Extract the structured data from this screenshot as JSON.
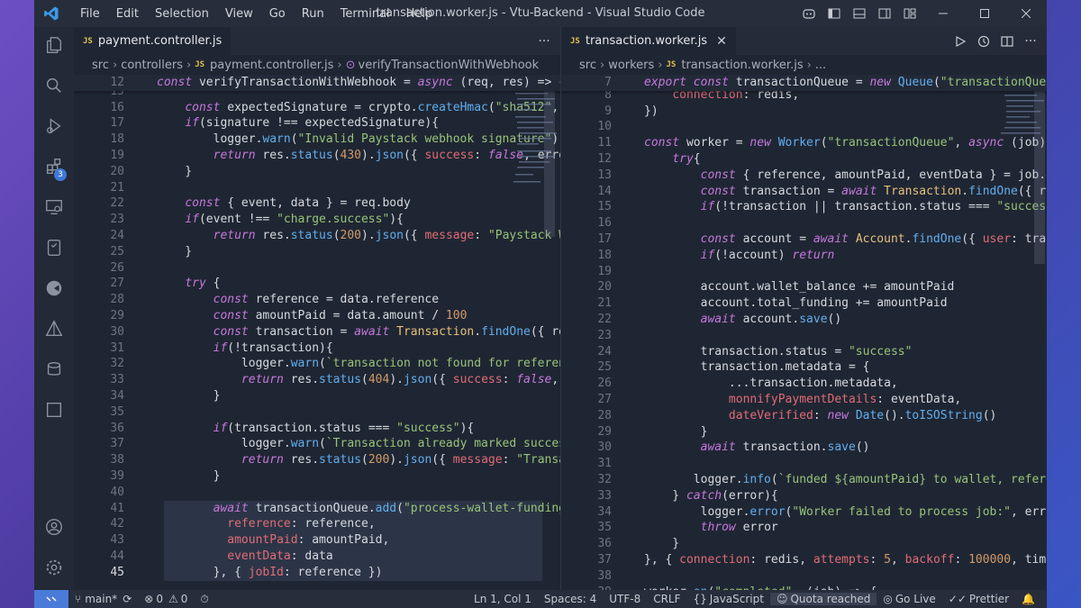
{
  "titlebar": {
    "menu": [
      "File",
      "Edit",
      "Selection",
      "View",
      "Go",
      "Run",
      "Terminal",
      "Help"
    ],
    "title": "transaction.worker.js - Vtu-Backend - Visual Studio Code"
  },
  "activity": {
    "extensions_badge": "3"
  },
  "left_editor": {
    "tab_label": "payment.controller.js",
    "tab_icon": "JS",
    "more": "···",
    "breadcrumb": [
      "src",
      "controllers",
      "payment.controller.js",
      "verifyTransactionWithWebhook"
    ],
    "sticky": {
      "num": "12",
      "text": "const verifyTransactionWithWebhook = async (req, res) => {"
    },
    "lines": [
      {
        "num": "15",
        "text": ""
      },
      {
        "num": "16",
        "text": "    const expectedSignature = crypto.createHmac(\"sha512\", "
      },
      {
        "num": "17",
        "text": "    if(signature !== expectedSignature){"
      },
      {
        "num": "18",
        "text": "        logger.warn(\"Invalid Paystack webhook signature\")"
      },
      {
        "num": "19",
        "text": "        return res.status(430).json({ success: false, erro"
      },
      {
        "num": "20",
        "text": "    }"
      },
      {
        "num": "21",
        "text": ""
      },
      {
        "num": "22",
        "text": "    const { event, data } = req.body"
      },
      {
        "num": "23",
        "text": "    if(event !== \"charge.success\"){"
      },
      {
        "num": "24",
        "text": "        return res.status(200).json({ message: \"Paystack W"
      },
      {
        "num": "25",
        "text": "    }"
      },
      {
        "num": "26",
        "text": ""
      },
      {
        "num": "27",
        "text": "    try {"
      },
      {
        "num": "28",
        "text": "        const reference = data.reference"
      },
      {
        "num": "29",
        "text": "        const amountPaid = data.amount / 100"
      },
      {
        "num": "30",
        "text": "        const transaction = await Transaction.findOne({ re"
      },
      {
        "num": "31",
        "text": "        if(!transaction){"
      },
      {
        "num": "32",
        "text": "            logger.warn(`transaction not found for referen"
      },
      {
        "num": "33",
        "text": "            return res.status(404).json({ success: false, "
      },
      {
        "num": "34",
        "text": "        }"
      },
      {
        "num": "35",
        "text": ""
      },
      {
        "num": "36",
        "text": "        if(transaction.status === \"success\"){"
      },
      {
        "num": "37",
        "text": "            logger.warn(`Transaction already marked succes"
      },
      {
        "num": "38",
        "text": "            return res.status(200).json({ message: \"Transa"
      },
      {
        "num": "39",
        "text": "        }"
      },
      {
        "num": "40",
        "text": ""
      },
      {
        "num": "41",
        "text": "        await transactionQueue.add(\"process-wallet-funding"
      },
      {
        "num": "42",
        "text": "          reference: reference,"
      },
      {
        "num": "43",
        "text": "          amountPaid: amountPaid,"
      },
      {
        "num": "44",
        "text": "          eventData: data"
      },
      {
        "num": "45",
        "text": "        }, { jobId: reference })"
      }
    ]
  },
  "right_editor": {
    "tab_label": "transaction.worker.js",
    "tab_icon": "JS",
    "breadcrumb": [
      "src",
      "workers",
      "transaction.worker.js",
      "..."
    ],
    "sticky": {
      "num": "7",
      "text": "export const transactionQueue = new Queue(\"transactionQueu"
    },
    "lines": [
      {
        "num": "8",
        "text": "    connection: redis,"
      },
      {
        "num": "9",
        "text": "})"
      },
      {
        "num": "10",
        "text": ""
      },
      {
        "num": "11",
        "text": "const worker = new Worker(\"transactionQueue\", async (job)"
      },
      {
        "num": "12",
        "text": "    try{"
      },
      {
        "num": "13",
        "text": "        const { reference, amountPaid, eventData } = job.d"
      },
      {
        "num": "14",
        "text": "        const transaction = await Transaction.findOne({ re"
      },
      {
        "num": "15",
        "text": "        if(!transaction || transaction.status === \"success"
      },
      {
        "num": "16",
        "text": ""
      },
      {
        "num": "17",
        "text": "        const account = await Account.findOne({ user: tran"
      },
      {
        "num": "18",
        "text": "        if(!account) return"
      },
      {
        "num": "19",
        "text": ""
      },
      {
        "num": "20",
        "text": "        account.wallet_balance += amountPaid"
      },
      {
        "num": "21",
        "text": "        account.total_funding += amountPaid"
      },
      {
        "num": "22",
        "text": "        await account.save()"
      },
      {
        "num": "23",
        "text": ""
      },
      {
        "num": "24",
        "text": "        transaction.status = \"success\""
      },
      {
        "num": "25",
        "text": "        transaction.metadata = {"
      },
      {
        "num": "26",
        "text": "            ...transaction.metadata,"
      },
      {
        "num": "27",
        "text": "            monnifyPaymentDetails: eventData,"
      },
      {
        "num": "28",
        "text": "            dateVerified: new Date().toISOString()"
      },
      {
        "num": "29",
        "text": "        }"
      },
      {
        "num": "30",
        "text": "        await transaction.save()"
      },
      {
        "num": "31",
        "text": ""
      },
      {
        "num": "32",
        "text": "       logger.info(`funded ${amountPaid} to wallet, refere"
      },
      {
        "num": "33",
        "text": "    } catch(error){"
      },
      {
        "num": "34",
        "text": "        logger.error(\"Worker failed to process job:\", erro"
      },
      {
        "num": "35",
        "text": "        throw error"
      },
      {
        "num": "36",
        "text": "    }"
      },
      {
        "num": "37",
        "text": "}, { connection: redis, attempts: 5, backoff: 100000, time"
      },
      {
        "num": "38",
        "text": ""
      },
      {
        "num": "39",
        "text": "worker.on(\"completed\", (job) => {"
      }
    ]
  },
  "statusbar": {
    "branch": "main*",
    "errors": "0",
    "warnings": "0",
    "position": "Ln 1, Col 1",
    "spaces": "Spaces: 4",
    "encoding": "UTF-8",
    "eol": "CRLF",
    "language": "JavaScript",
    "quota": "Quota reached",
    "golive": "Go Live",
    "prettier": "Prettier"
  },
  "colors": {
    "accent": "#4a7bd8",
    "background": "#1f2633",
    "keyword": "#c678dd",
    "string": "#98c379",
    "function": "#61afef"
  }
}
